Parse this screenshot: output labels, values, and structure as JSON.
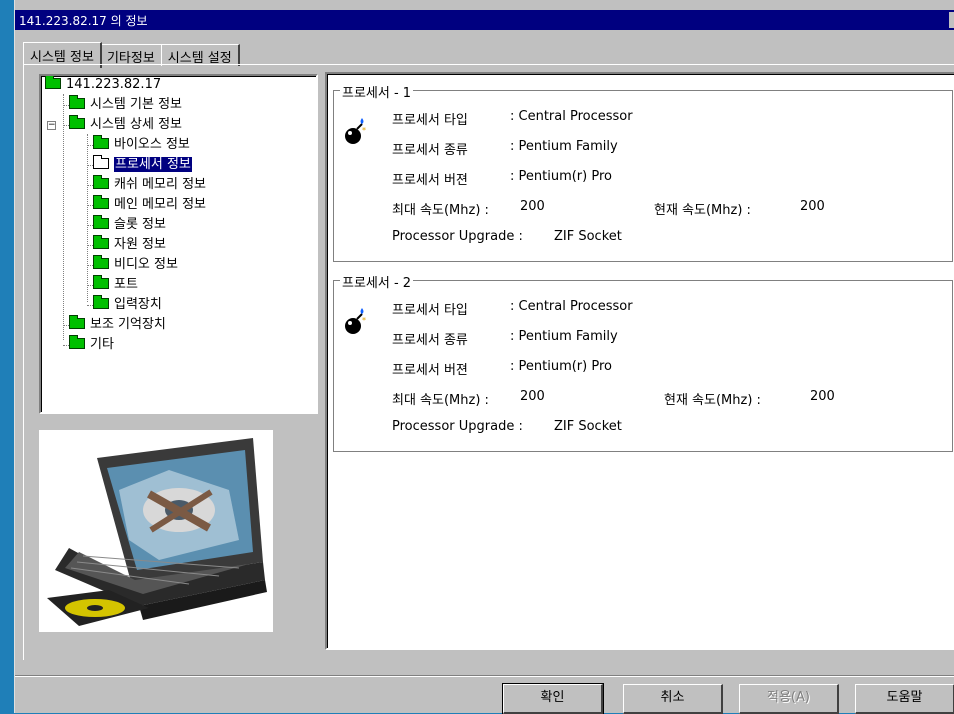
{
  "window": {
    "title": "141.223.82.17 의 정보"
  },
  "tabs": [
    {
      "label": "시스템 정보"
    },
    {
      "label": "기타정보"
    },
    {
      "label": "시스템 설정"
    }
  ],
  "tree": {
    "root": "141.223.82.17",
    "items": [
      {
        "label": "시스템 기본 정보"
      },
      {
        "label": "시스템 상세 정보"
      },
      {
        "label": "바이오스 정보"
      },
      {
        "label": "프로세서 정보"
      },
      {
        "label": "캐쉬 메모리 정보"
      },
      {
        "label": "메인 메모리 정보"
      },
      {
        "label": "슬롯 정보"
      },
      {
        "label": "자원 정보"
      },
      {
        "label": "비디오 정보"
      },
      {
        "label": "포트"
      },
      {
        "label": "입력장치"
      },
      {
        "label": "보조 기억장치"
      },
      {
        "label": "기타"
      }
    ],
    "expander_symbol": "−"
  },
  "processors": [
    {
      "title": "프로세서 - 1",
      "type_label": "프로세서 타입",
      "type_value": ": Central Processor",
      "kind_label": "프로세서 종류",
      "kind_value": ": Pentium Family",
      "version_label": "프로세서 버젼",
      "version_value": ": Pentium(r) Pro",
      "max_speed_label": "최대 속도(Mhz) :",
      "max_speed_value": "200",
      "cur_speed_label": "현재 속도(Mhz) :",
      "cur_speed_value": "200",
      "upgrade_label": "Processor Upgrade :",
      "upgrade_value": "ZIF Socket"
    },
    {
      "title": "프로세서 - 2",
      "type_label": "프로세서 타입",
      "type_value": ": Central Processor",
      "kind_label": "프로세서 종류",
      "kind_value": ": Pentium Family",
      "version_label": "프로세서 버젼",
      "version_value": ": Pentium(r) Pro",
      "max_speed_label": "최대 속도(Mhz) :",
      "max_speed_value": "200",
      "cur_speed_label": "현재 속도(Mhz) :",
      "cur_speed_value": "200",
      "upgrade_label": "Processor Upgrade :",
      "upgrade_value": "ZIF Socket"
    }
  ],
  "buttons": {
    "ok": "확인",
    "cancel": "취소",
    "apply": "적용(A)",
    "help": "도움말"
  },
  "icons": {
    "tree_folder": "folder-icon",
    "processor": "bomb-processor-icon",
    "computer_picture": "laptop-image"
  },
  "colors": {
    "desktop": "#1f7fb8",
    "titlebar": "#000080",
    "folder": "#00c000",
    "selection": "#000080"
  }
}
